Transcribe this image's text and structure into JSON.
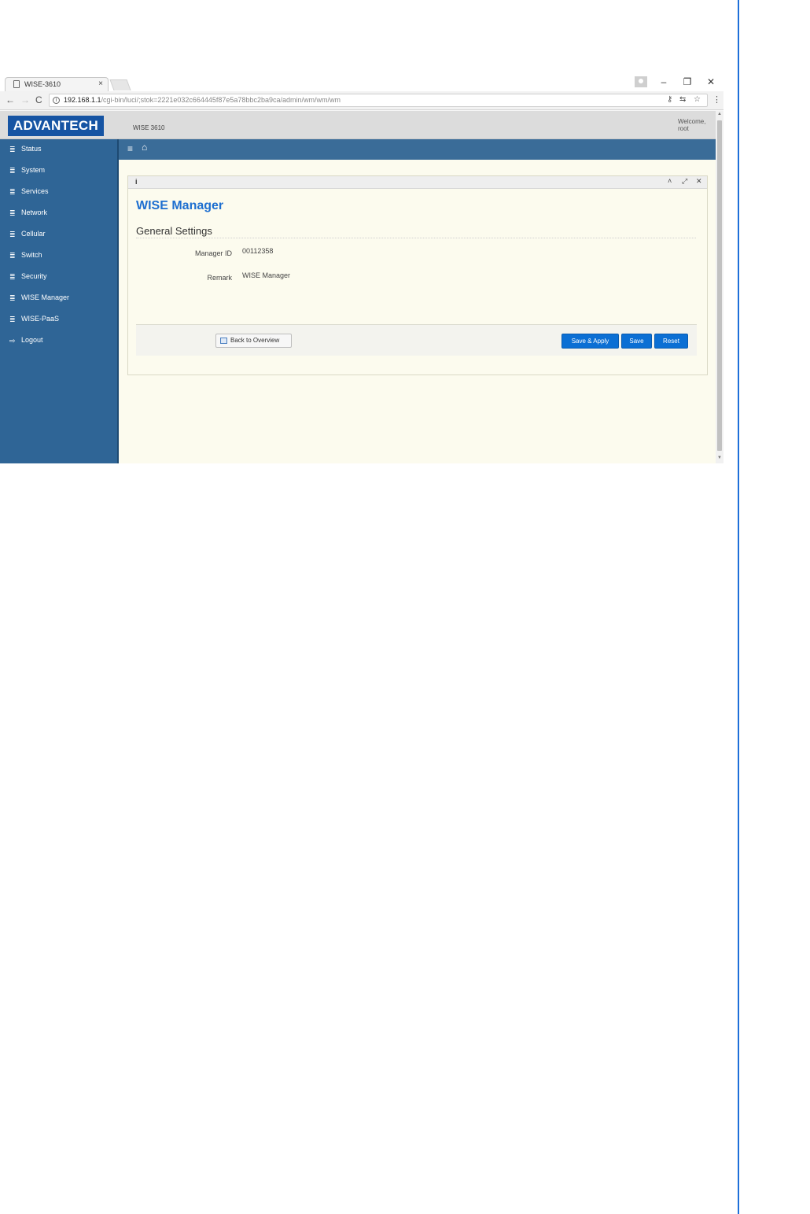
{
  "browser": {
    "tab_title": "WISE-3610",
    "tab_close": "×",
    "url_host": "192.168.1.1",
    "url_path": "/cgi-bin/luci/;stok=2221e032c664445f87e5a78bbc2ba9ca/admin/wm/wm/wm",
    "nav": {
      "back": "←",
      "forward": "→",
      "reload": "C"
    },
    "window": {
      "minimize": "–",
      "restore": "❐",
      "close": "✕"
    },
    "omnibox_icons": {
      "key": "⚷",
      "translate": "⇆",
      "star": "☆",
      "menu": "⋮"
    }
  },
  "header": {
    "logo": "ADVANTECH",
    "product": "WISE 3610",
    "welcome_line1": "Welcome,",
    "welcome_line2": "root"
  },
  "sidebar": {
    "icon": "≣",
    "items": [
      {
        "label": "Status"
      },
      {
        "label": "System"
      },
      {
        "label": "Services"
      },
      {
        "label": "Network"
      },
      {
        "label": "Cellular"
      },
      {
        "label": "Switch"
      },
      {
        "label": "Security"
      },
      {
        "label": "WISE Manager"
      },
      {
        "label": "WISE-PaaS"
      },
      {
        "label": "Logout",
        "icon": "⇨"
      }
    ]
  },
  "topbar": {
    "menu_icon": "≡",
    "home_icon": "⌂"
  },
  "panel": {
    "info_icon": "i",
    "controls": {
      "collapse": "˄",
      "expand": "⤢",
      "close": "✕"
    },
    "title": "WISE Manager",
    "section": "General Settings",
    "fields": [
      {
        "label": "Manager ID",
        "value": "00112358"
      },
      {
        "label": "Remark",
        "value": "WISE Manager"
      }
    ],
    "buttons": {
      "back": "Back to Overview",
      "save_apply": "Save & Apply",
      "save": "Save",
      "reset": "Reset"
    }
  },
  "colors": {
    "accent": "#0b6fd4",
    "sidebar": "#2f6596",
    "logo_bg": "#1654a3",
    "content_bg": "#fcfbee"
  }
}
